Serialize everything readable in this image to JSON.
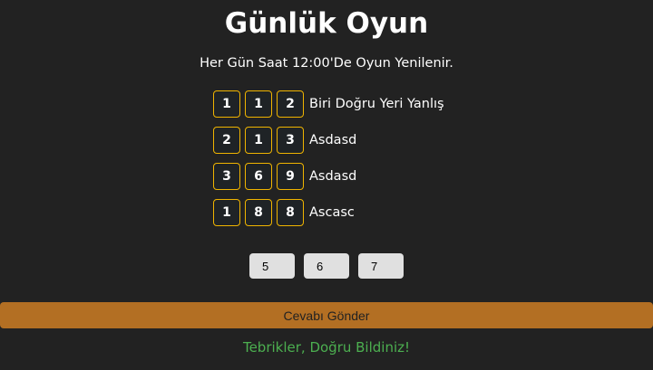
{
  "header": {
    "title": "Günlük Oyun",
    "subtitle": "Her Gün Saat 12:00'De Oyun Yenilenir."
  },
  "colors": {
    "accent": "#b36f23",
    "box_border": "#f0b400",
    "success": "#4caf50"
  },
  "clues": [
    {
      "digits": [
        "1",
        "1",
        "2"
      ],
      "hint": "Biri Doğru Yeri Yanlış"
    },
    {
      "digits": [
        "2",
        "1",
        "3"
      ],
      "hint": "Asdasd"
    },
    {
      "digits": [
        "3",
        "6",
        "9"
      ],
      "hint": "Asdasd"
    },
    {
      "digits": [
        "1",
        "8",
        "8"
      ],
      "hint": "Ascasc"
    }
  ],
  "answer": {
    "values": [
      "5",
      "6",
      "7"
    ]
  },
  "submit_label": "Cevabı Gönder",
  "result_message": "Tebrikler, Doğru Bildiniz!"
}
